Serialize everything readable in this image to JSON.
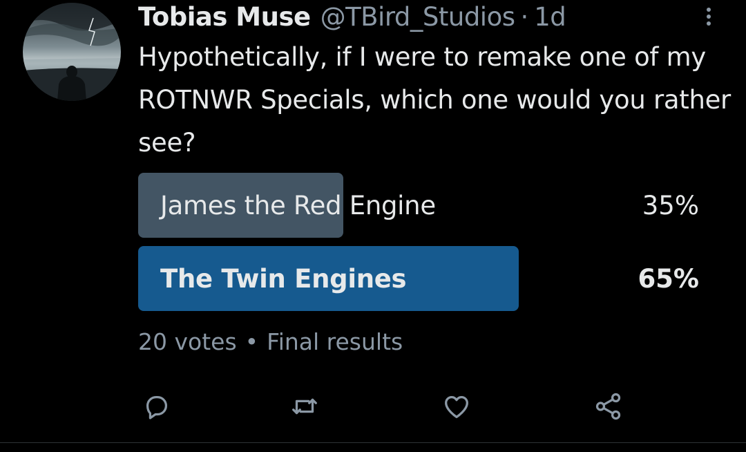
{
  "tweet": {
    "author_name": "Tobias Muse",
    "author_handle": "@TBird_Studios",
    "separator": "·",
    "timestamp": "1d",
    "avatar_icon": "stormy-sea-silhouette-avatar",
    "text": "Hypothetically, if I were to remake one of my ROTNWR Specials, which one would you rather see?"
  },
  "poll": {
    "options": [
      {
        "label": "James the Red Engine",
        "percent_text": "35%",
        "percent": 35,
        "bar_color": "#435564",
        "winner": false
      },
      {
        "label": "The Twin Engines",
        "percent_text": "65%",
        "percent": 65,
        "bar_color": "#165a8f",
        "winner": true
      }
    ],
    "votes": "20 votes",
    "meta_separator": "•",
    "status": "Final results"
  },
  "actions": {
    "icons": [
      "reply-icon",
      "retweet-icon",
      "like-icon",
      "share-icon"
    ]
  },
  "colors": {
    "background": "#000000",
    "text_primary": "#e7e9ea",
    "text_secondary": "#8b98a5",
    "winner_bar": "#165a8f",
    "loser_bar": "#435564"
  }
}
